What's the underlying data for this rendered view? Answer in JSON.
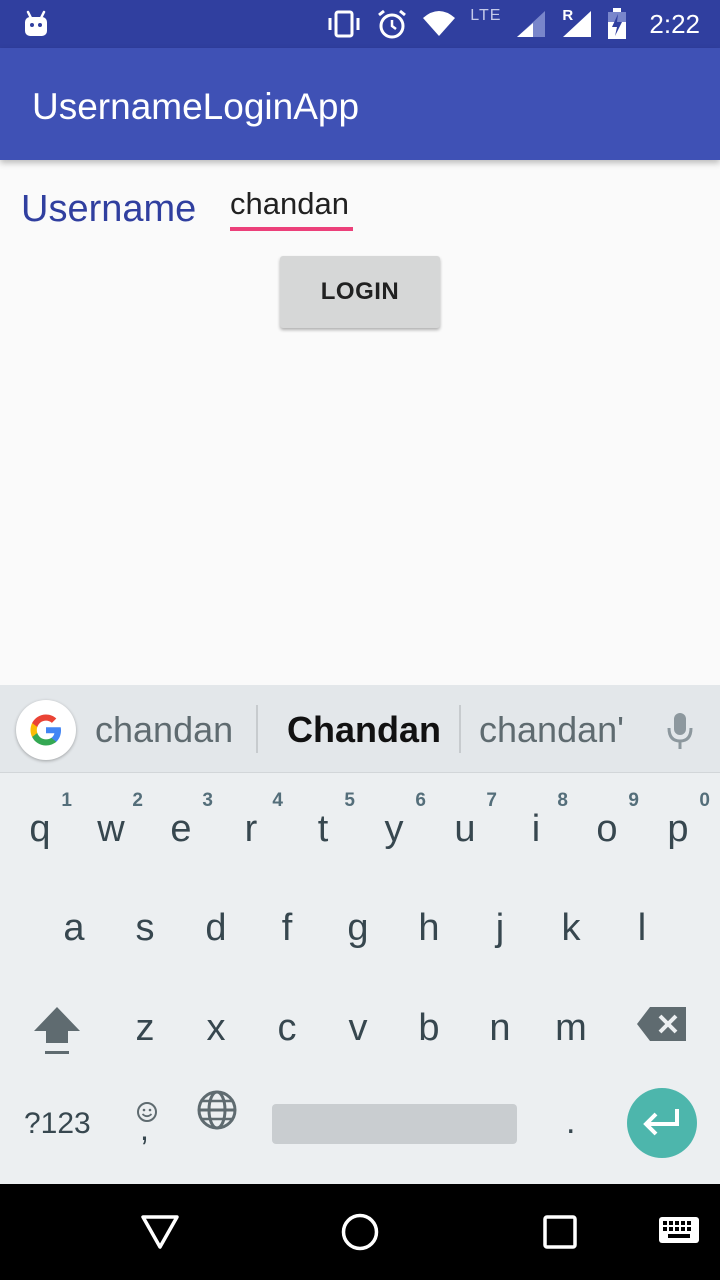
{
  "status_bar": {
    "time": "2:22",
    "network_label": "LTE",
    "roaming_label": "R",
    "icons": [
      "android-debug-icon",
      "vibrate-icon",
      "alarm-icon",
      "wifi-icon",
      "signal-icon",
      "signal-roaming-icon",
      "battery-charging-icon"
    ]
  },
  "app_bar": {
    "title": "UsernameLoginApp"
  },
  "form": {
    "username_label": "Username",
    "username_value": "chandan",
    "login_label": "LOGIN"
  },
  "keyboard": {
    "suggestions": [
      "chandan",
      "Chandan",
      "chandan'"
    ],
    "row1": [
      {
        "key": "q",
        "hint": "1"
      },
      {
        "key": "w",
        "hint": "2"
      },
      {
        "key": "e",
        "hint": "3"
      },
      {
        "key": "r",
        "hint": "4"
      },
      {
        "key": "t",
        "hint": "5"
      },
      {
        "key": "y",
        "hint": "6"
      },
      {
        "key": "u",
        "hint": "7"
      },
      {
        "key": "i",
        "hint": "8"
      },
      {
        "key": "o",
        "hint": "9"
      },
      {
        "key": "p",
        "hint": "0"
      }
    ],
    "row2": [
      "a",
      "s",
      "d",
      "f",
      "g",
      "h",
      "j",
      "k",
      "l"
    ],
    "row3": [
      "z",
      "x",
      "c",
      "v",
      "b",
      "n",
      "m"
    ],
    "symbols_label": "?123",
    "comma_label": ",",
    "period_label": ".",
    "accent_color": "#4db6ac"
  },
  "nav_bar": {
    "icons": [
      "back-icon",
      "home-icon",
      "recents-icon",
      "keyboard-switch-icon"
    ]
  }
}
